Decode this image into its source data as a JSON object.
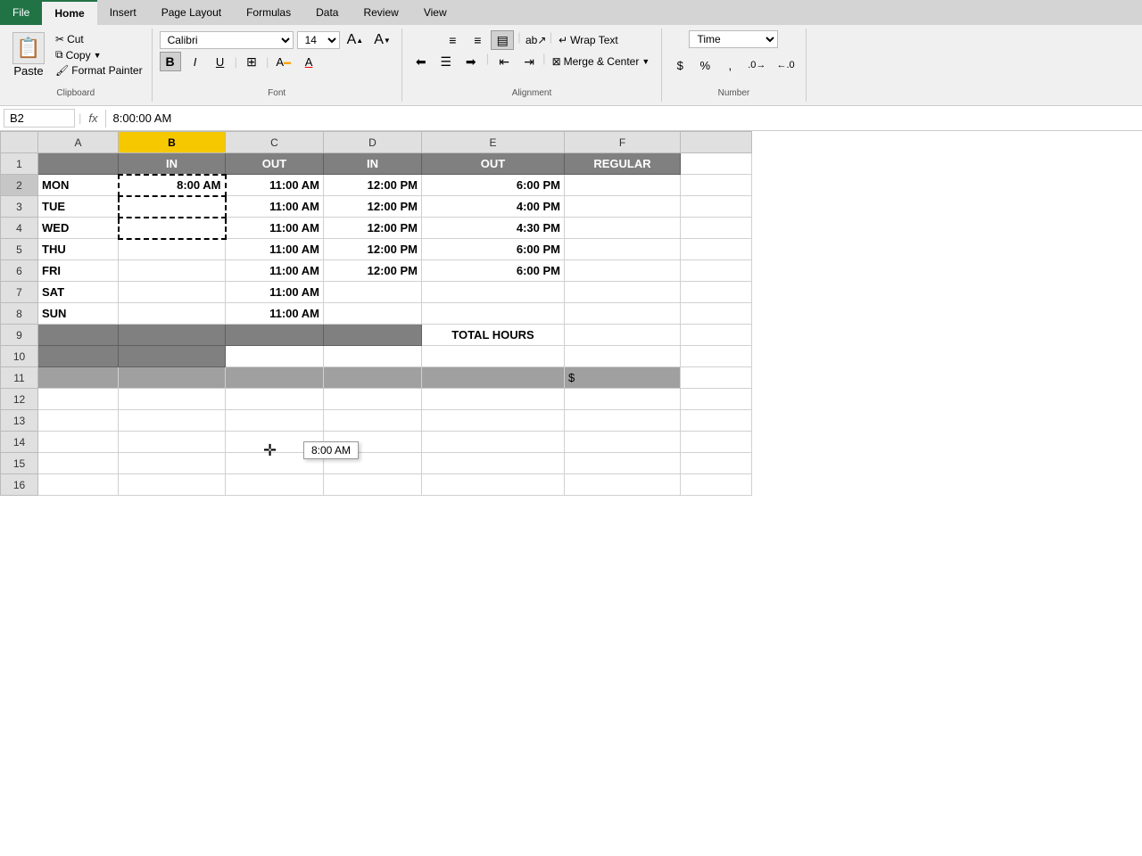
{
  "ribbon": {
    "tabs": [
      "File",
      "Home",
      "Insert",
      "Page Layout",
      "Formulas",
      "Data",
      "Review",
      "View"
    ],
    "active_tab": "Home",
    "file_tab": "File"
  },
  "clipboard": {
    "paste_label": "Paste",
    "cut_label": "Cut",
    "copy_label": "Copy",
    "format_painter_label": "Format Painter",
    "group_label": "Clipboard"
  },
  "font": {
    "family": "Calibri",
    "size": "14",
    "bold_label": "B",
    "italic_label": "I",
    "underline_label": "U",
    "group_label": "Font"
  },
  "alignment": {
    "wrap_text_label": "Wrap Text",
    "merge_center_label": "Merge & Center",
    "group_label": "Alignment"
  },
  "number": {
    "format": "Time",
    "group_label": "Number"
  },
  "formula_bar": {
    "cell_ref": "B2",
    "formula": "8:00:00 AM"
  },
  "columns": [
    "A",
    "B",
    "C",
    "D",
    "E",
    "F"
  ],
  "rows": [
    {
      "row_num": 1,
      "cells": [
        "",
        "IN",
        "OUT",
        "IN",
        "OUT",
        "REGULAR"
      ]
    },
    {
      "row_num": 2,
      "cells": [
        "MON",
        "8:00 AM",
        "11:00 AM",
        "12:00 PM",
        "6:00 PM",
        ""
      ]
    },
    {
      "row_num": 3,
      "cells": [
        "TUE",
        "",
        "11:00 AM",
        "12:00 PM",
        "4:00 PM",
        ""
      ]
    },
    {
      "row_num": 4,
      "cells": [
        "WED",
        "",
        "11:00 AM",
        "12:00 PM",
        "4:30 PM",
        ""
      ]
    },
    {
      "row_num": 5,
      "cells": [
        "THU",
        "",
        "11:00 AM",
        "12:00 PM",
        "6:00 PM",
        ""
      ]
    },
    {
      "row_num": 6,
      "cells": [
        "FRI",
        "",
        "11:00 AM",
        "12:00 PM",
        "6:00 PM",
        ""
      ]
    },
    {
      "row_num": 7,
      "cells": [
        "SAT",
        "",
        "11:00 AM",
        "",
        "",
        ""
      ]
    },
    {
      "row_num": 8,
      "cells": [
        "SUN",
        "",
        "11:00 AM",
        "",
        "",
        ""
      ]
    },
    {
      "row_num": 9,
      "cells": [
        "",
        "",
        "",
        "",
        "TOTAL HOURS",
        ""
      ]
    },
    {
      "row_num": 10,
      "cells": [
        "",
        "",
        "",
        "",
        "",
        ""
      ]
    },
    {
      "row_num": 11,
      "cells": [
        "",
        "",
        "",
        "",
        "",
        "$"
      ]
    },
    {
      "row_num": 12,
      "cells": [
        "",
        "",
        "",
        "",
        "",
        ""
      ]
    },
    {
      "row_num": 13,
      "cells": [
        "",
        "",
        "",
        "",
        "",
        ""
      ]
    },
    {
      "row_num": 14,
      "cells": [
        "",
        "",
        "",
        "",
        "",
        ""
      ]
    },
    {
      "row_num": 15,
      "cells": [
        "",
        "",
        "",
        "",
        "",
        ""
      ]
    },
    {
      "row_num": 16,
      "cells": [
        "",
        "",
        "",
        "",
        "",
        ""
      ]
    }
  ],
  "tooltip": {
    "text": "8:00 AM",
    "visible": true
  },
  "colors": {
    "selected_col_header": "#f6c800",
    "dark_cell": "#808080",
    "gray_cell": "#a8a8a8",
    "header_bg": "#e0e0e0",
    "active_border": "#217346"
  }
}
